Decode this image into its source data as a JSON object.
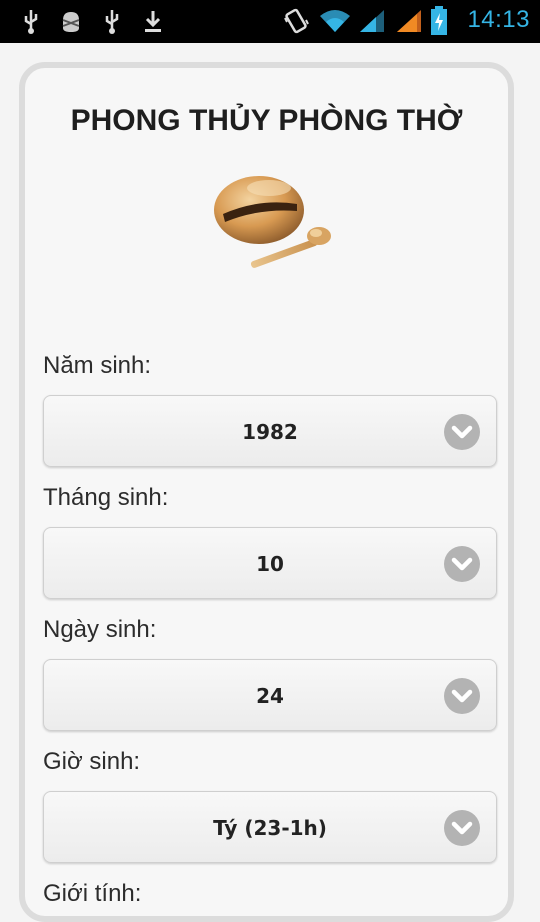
{
  "status_bar": {
    "time": "14:13",
    "icons": [
      "usb-icon",
      "android-debug-icon",
      "usb-icon",
      "download-icon",
      "vibrate-icon",
      "wifi-icon",
      "signal-icon",
      "signal-icon",
      "battery-charging-icon"
    ]
  },
  "page": {
    "title": "PHONG THỦY PHÒNG THỜ",
    "logo": "wooden-bell-icon"
  },
  "form": {
    "fields": [
      {
        "label": "Năm sinh:",
        "value": "1982"
      },
      {
        "label": "Tháng sinh:",
        "value": "10"
      },
      {
        "label": "Ngày sinh:",
        "value": "24"
      },
      {
        "label": "Giờ sinh:",
        "value": "Tý (23-1h)"
      },
      {
        "label": "Giới tính:"
      }
    ]
  },
  "colors": {
    "status_time": "#35b5e5",
    "card_border": "#dcdcdc",
    "chevron_bg": "#b3b3b3"
  }
}
